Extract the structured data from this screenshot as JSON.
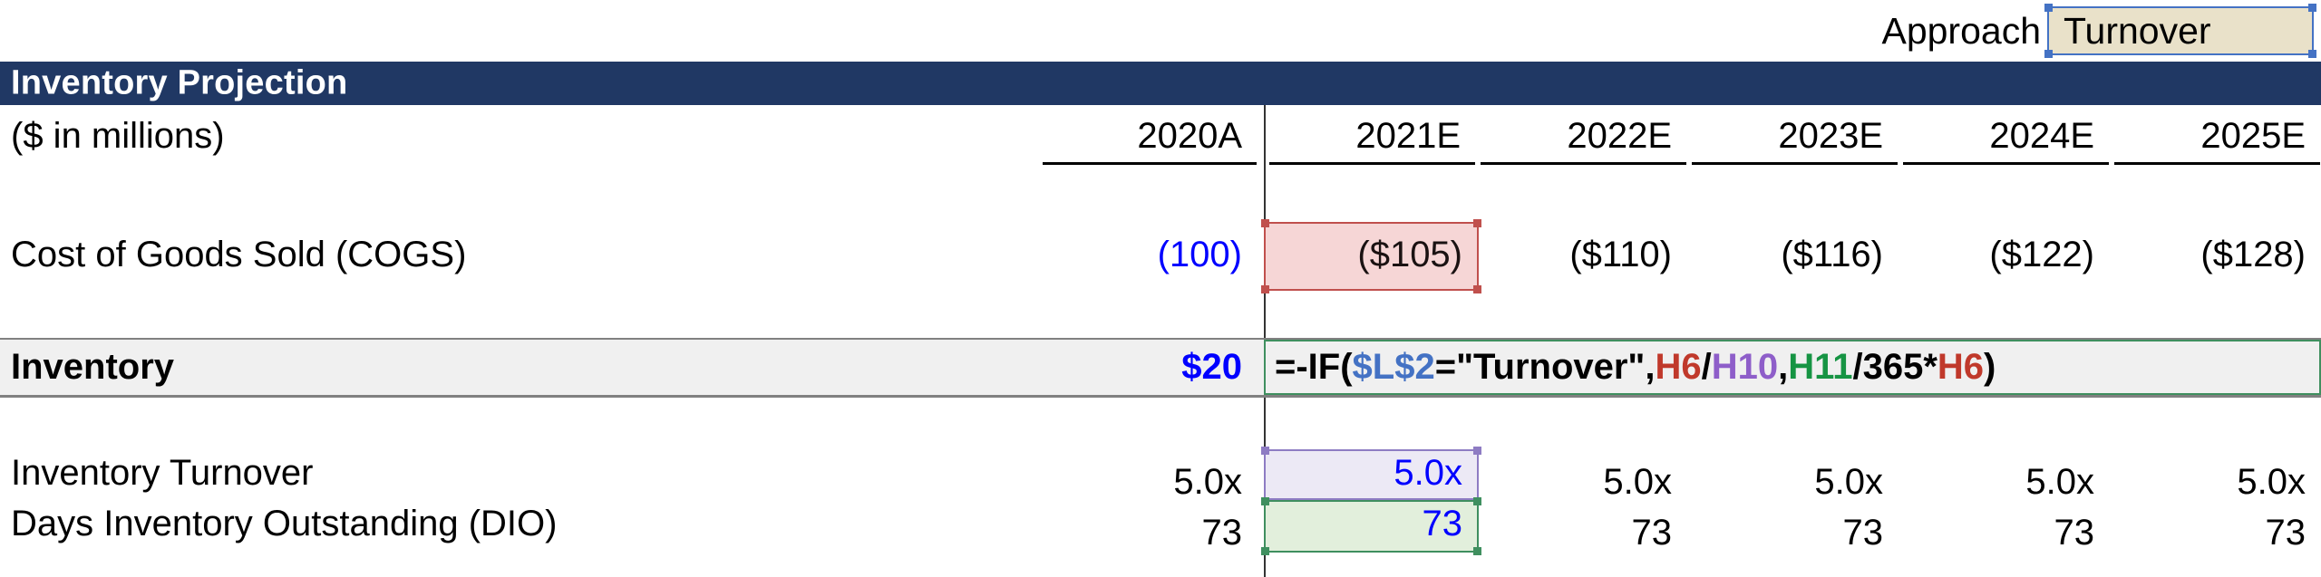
{
  "approach": {
    "label": "Approach",
    "value": "Turnover",
    "cell_bg": "#e9e1c9",
    "selection_color": "#4472c4"
  },
  "title": {
    "text": "Inventory Projection",
    "bar_color": "#203864",
    "text_color": "#ffffff"
  },
  "units_label": "($ in millions)",
  "columns": [
    {
      "key": "c2020",
      "header": "2020A"
    },
    {
      "key": "c2021",
      "header": "2021E"
    },
    {
      "key": "c2022",
      "header": "2022E"
    },
    {
      "key": "c2023",
      "header": "2023E"
    },
    {
      "key": "c2024",
      "header": "2024E"
    },
    {
      "key": "c2025",
      "header": "2025E"
    }
  ],
  "rows": {
    "cogs": {
      "label": "Cost of Goods Sold (COGS)",
      "values": [
        "(100)",
        "($105)",
        "($110)",
        "($116)",
        "($122)",
        "($128)"
      ],
      "highlight_index": 1,
      "highlight_bg": "#f6d6d6",
      "highlight_border": "#c0504d",
      "c2020_color": "#0000ff"
    },
    "inventory": {
      "label": "Inventory",
      "value_2020": "$20",
      "value_color": "#0000ff",
      "band_bg": "#f0f0f0",
      "formula_border": "#3f8f5f",
      "formula_text": "=-IF($L$2=\"Turnover\",H6/H10,H11/365*H6)",
      "formula_tokens": [
        {
          "t": "=-IF(",
          "c": "black"
        },
        {
          "t": "$L$2",
          "c": "blue"
        },
        {
          "t": "=\"Turnover\",",
          "c": "black"
        },
        {
          "t": "H6",
          "c": "red"
        },
        {
          "t": "/",
          "c": "black"
        },
        {
          "t": "H10",
          "c": "purple"
        },
        {
          "t": ",",
          "c": "black"
        },
        {
          "t": "H11",
          "c": "green"
        },
        {
          "t": "/365*",
          "c": "black"
        },
        {
          "t": "H6",
          "c": "red"
        },
        {
          "t": ")",
          "c": "black"
        }
      ],
      "token_colors": {
        "black": "#000000",
        "blue": "#4472c4",
        "red": "#c0392b",
        "purple": "#8e5ec9",
        "green": "#169443"
      }
    },
    "turnover": {
      "label": "Inventory Turnover",
      "values": [
        "5.0x",
        "5.0x",
        "5.0x",
        "5.0x",
        "5.0x",
        "5.0x"
      ],
      "highlight_index": 1,
      "highlight_bg": "#ece9f5",
      "highlight_border": "#8e7cc3",
      "highlight_text_color": "#0000ff"
    },
    "dio": {
      "label": "Days Inventory Outstanding (DIO)",
      "values": [
        "73",
        "73",
        "73",
        "73",
        "73",
        "73"
      ],
      "highlight_index": 1,
      "highlight_bg": "#e2efdc",
      "highlight_border": "#3f8f5f",
      "highlight_text_color": "#0000ff"
    }
  }
}
